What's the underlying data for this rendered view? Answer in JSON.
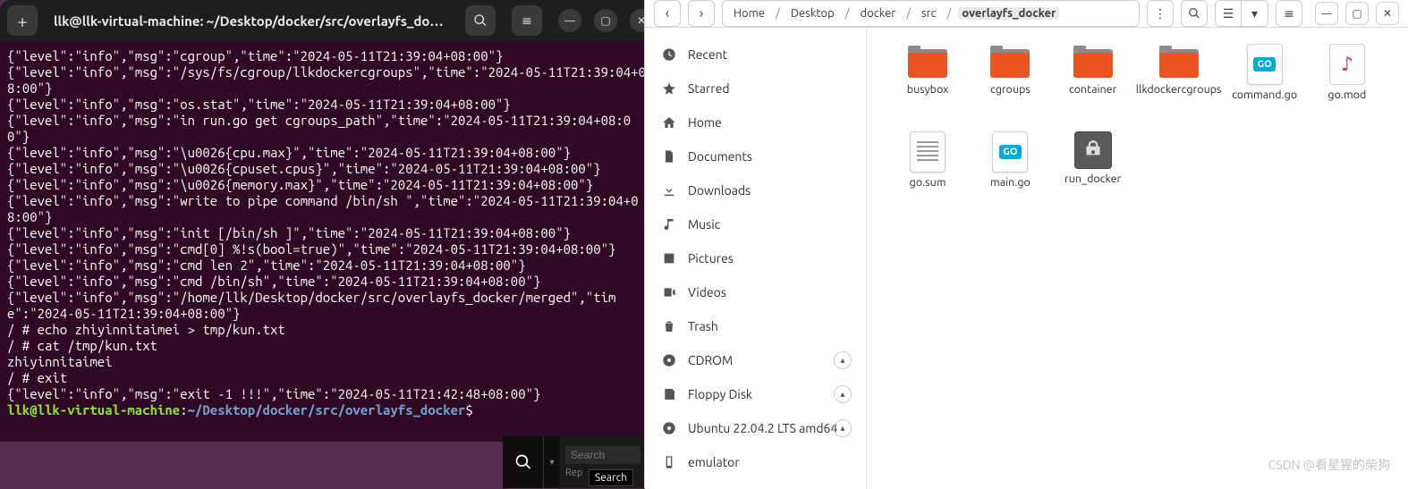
{
  "terminal": {
    "title": "llk@llk-virtual-machine: ~/Desktop/docker/src/overlayfs_doc…",
    "lines": [
      "{\"level\":\"info\",\"msg\":\"cgroup\",\"time\":\"2024-05-11T21:39:04+08:00\"}",
      "{\"level\":\"info\",\"msg\":\"/sys/fs/cgroup/llkdockercgroups\",\"time\":\"2024-05-11T21:39:04+08:00\"}",
      "{\"level\":\"info\",\"msg\":\"os.stat\",\"time\":\"2024-05-11T21:39:04+08:00\"}",
      "{\"level\":\"info\",\"msg\":\"in run.go get cgroups_path\",\"time\":\"2024-05-11T21:39:04+08:00\"}",
      "{\"level\":\"info\",\"msg\":\"\\u0026{cpu.max}\",\"time\":\"2024-05-11T21:39:04+08:00\"}",
      "{\"level\":\"info\",\"msg\":\"\\u0026{cpuset.cpus}\",\"time\":\"2024-05-11T21:39:04+08:00\"}",
      "{\"level\":\"info\",\"msg\":\"\\u0026{memory.max}\",\"time\":\"2024-05-11T21:39:04+08:00\"}",
      "{\"level\":\"info\",\"msg\":\"write to pipe command /bin/sh \",\"time\":\"2024-05-11T21:39:04+08:00\"}",
      "{\"level\":\"info\",\"msg\":\"init [/bin/sh ]\",\"time\":\"2024-05-11T21:39:04+08:00\"}",
      "{\"level\":\"info\",\"msg\":\"cmd[0] %!s(bool=true)\",\"time\":\"2024-05-11T21:39:04+08:00\"}",
      "{\"level\":\"info\",\"msg\":\"cmd len 2\",\"time\":\"2024-05-11T21:39:04+08:00\"}",
      "{\"level\":\"info\",\"msg\":\"cmd /bin/sh\",\"time\":\"2024-05-11T21:39:04+08:00\"}",
      "{\"level\":\"info\",\"msg\":\"/home/llk/Desktop/docker/src/overlayfs_docker/merged\",\"time\":\"2024-05-11T21:39:04+08:00\"}",
      "/ # echo zhiyinnitaimei > tmp/kun.txt",
      "/ # cat /tmp/kun.txt",
      "zhiyinnitaimei",
      "/ # exit",
      "{\"level\":\"info\",\"msg\":\"exit -1 !!!\",\"time\":\"2024-05-11T21:42:48+08:00\"}"
    ],
    "prompt": {
      "user": "llk@llk-virtual-machine",
      "sep": ":",
      "path": "~/Desktop/docker/src/overlayfs_docker",
      "end": "$"
    }
  },
  "search": {
    "placeholder": "Search",
    "rep": "Rep",
    "tooltip": "Search"
  },
  "files": {
    "breadcrumb": [
      "Home",
      "Desktop",
      "docker",
      "src",
      "overlayfs_docker"
    ],
    "sidebar": [
      {
        "icon": "clock",
        "label": "Recent",
        "eject": false
      },
      {
        "icon": "star",
        "label": "Starred",
        "eject": false
      },
      {
        "icon": "home",
        "label": "Home",
        "eject": false
      },
      {
        "icon": "doc",
        "label": "Documents",
        "eject": false
      },
      {
        "icon": "download",
        "label": "Downloads",
        "eject": false
      },
      {
        "icon": "music",
        "label": "Music",
        "eject": false
      },
      {
        "icon": "picture",
        "label": "Pictures",
        "eject": false
      },
      {
        "icon": "video",
        "label": "Videos",
        "eject": false
      },
      {
        "icon": "trash",
        "label": "Trash",
        "eject": false
      },
      {
        "icon": "disc",
        "label": "CDROM",
        "eject": true
      },
      {
        "icon": "floppy",
        "label": "Floppy Disk",
        "eject": true
      },
      {
        "icon": "disc",
        "label": "Ubuntu 22.04.2 LTS amd64",
        "eject": true
      },
      {
        "icon": "phone",
        "label": "emulator",
        "eject": false
      }
    ],
    "items": [
      {
        "type": "folder",
        "label": "busybox"
      },
      {
        "type": "folder",
        "label": "cgroups"
      },
      {
        "type": "folder",
        "label": "container"
      },
      {
        "type": "folder",
        "label": "llkdockercgroups"
      },
      {
        "type": "go",
        "label": "command.go"
      },
      {
        "type": "audio",
        "label": "go.mod"
      },
      {
        "type": "text",
        "label": "go.sum"
      },
      {
        "type": "go",
        "label": "main.go"
      },
      {
        "type": "binary",
        "label": "run_docker"
      }
    ]
  },
  "watermark": "CSDN @看星猩的柴狗"
}
